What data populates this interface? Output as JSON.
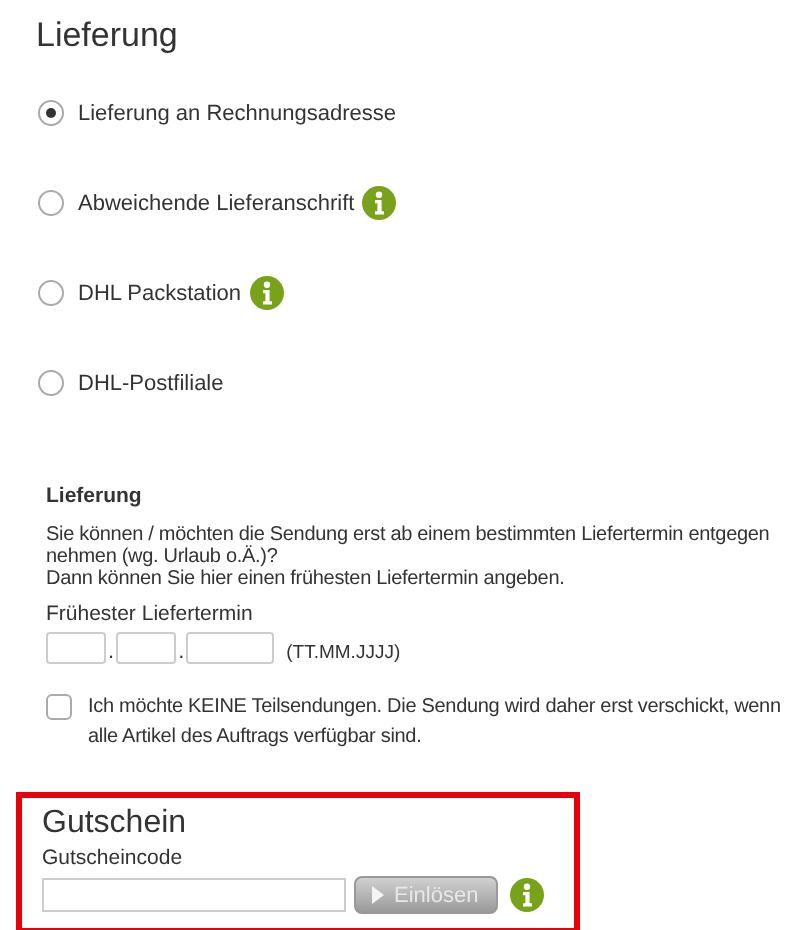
{
  "delivery": {
    "title": "Lieferung",
    "options": [
      {
        "label": "Lieferung an Rechnungsadresse",
        "selected": true,
        "info": false
      },
      {
        "label": "Abweichende Lieferanschrift",
        "selected": false,
        "info": true
      },
      {
        "label": "DHL Packstation",
        "selected": false,
        "info": true
      },
      {
        "label": "DHL-Postfiliale",
        "selected": false,
        "info": false
      }
    ]
  },
  "delivery_date": {
    "title": "Lieferung",
    "description_lines": [
      "Sie können / möchten die Sendung erst ab einem bestimmten Liefertermin entgegen nehmen (wg. Urlaub o.Ä.)?",
      "Dann können Sie hier einen frühesten Liefertermin angeben."
    ],
    "field_label": "Frühester Liefertermin",
    "separators": [
      ".",
      "."
    ],
    "format_hint": "(TT.MM.JJJJ)",
    "no_partial_shipments": {
      "label": "Ich möchte KEINE Teilsendungen. Die Sendung wird daher erst verschickt, wenn alle Artikel des Auftrags verfügbar sind.",
      "checked": false
    }
  },
  "voucher": {
    "title": "Gutschein",
    "highlighted": true,
    "field_label": "Gutscheincode",
    "button": {
      "label": "Einlösen",
      "disabled": true
    },
    "info": true
  }
}
